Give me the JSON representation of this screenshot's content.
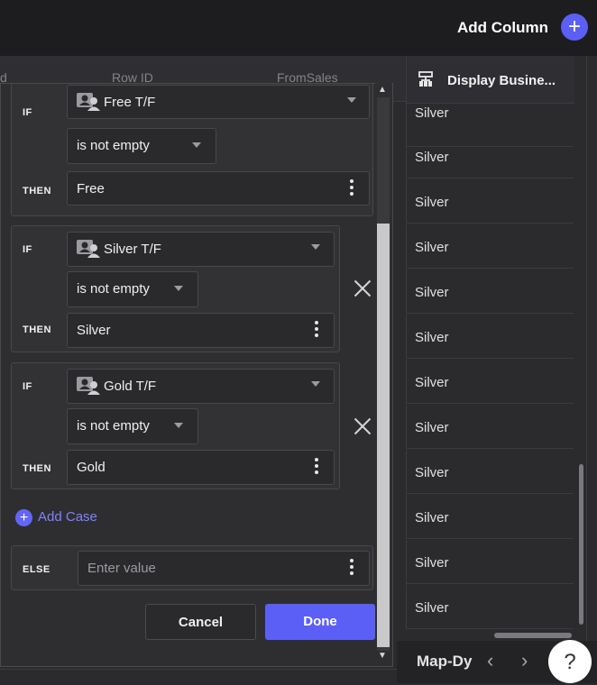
{
  "header": {
    "add_column_label": "Add Column",
    "add_column_icon": "+"
  },
  "grid": {
    "faint_headers": [
      "d",
      "Row ID",
      "FromSales"
    ],
    "column_title": "Display Busine...",
    "column_icon": "table-icon",
    "cells": [
      "Silver",
      "Silver",
      "Silver",
      "Silver",
      "Silver",
      "Silver",
      "Silver",
      "Silver",
      "Silver",
      "Silver",
      "Silver",
      "Silver"
    ]
  },
  "bottombar": {
    "tab_label": "Map-Dy",
    "prev": "‹",
    "next": "›",
    "help": "?"
  },
  "editor": {
    "if_label": "IF",
    "then_label": "THEN",
    "else_label": "ELSE",
    "cases": [
      {
        "column": "Free T/F",
        "operator": "is not empty",
        "value": "Free"
      },
      {
        "column": "Silver T/F",
        "operator": "is not empty",
        "value": "Silver"
      },
      {
        "column": "Gold T/F",
        "operator": "is not empty",
        "value": "Gold"
      }
    ],
    "add_case_label": "Add Case",
    "else_placeholder": "Enter value",
    "cancel_label": "Cancel",
    "done_label": "Done"
  },
  "colors": {
    "accent": "#5b5ff5",
    "background": "#2b2b2e",
    "panel": "#2e2e31"
  }
}
